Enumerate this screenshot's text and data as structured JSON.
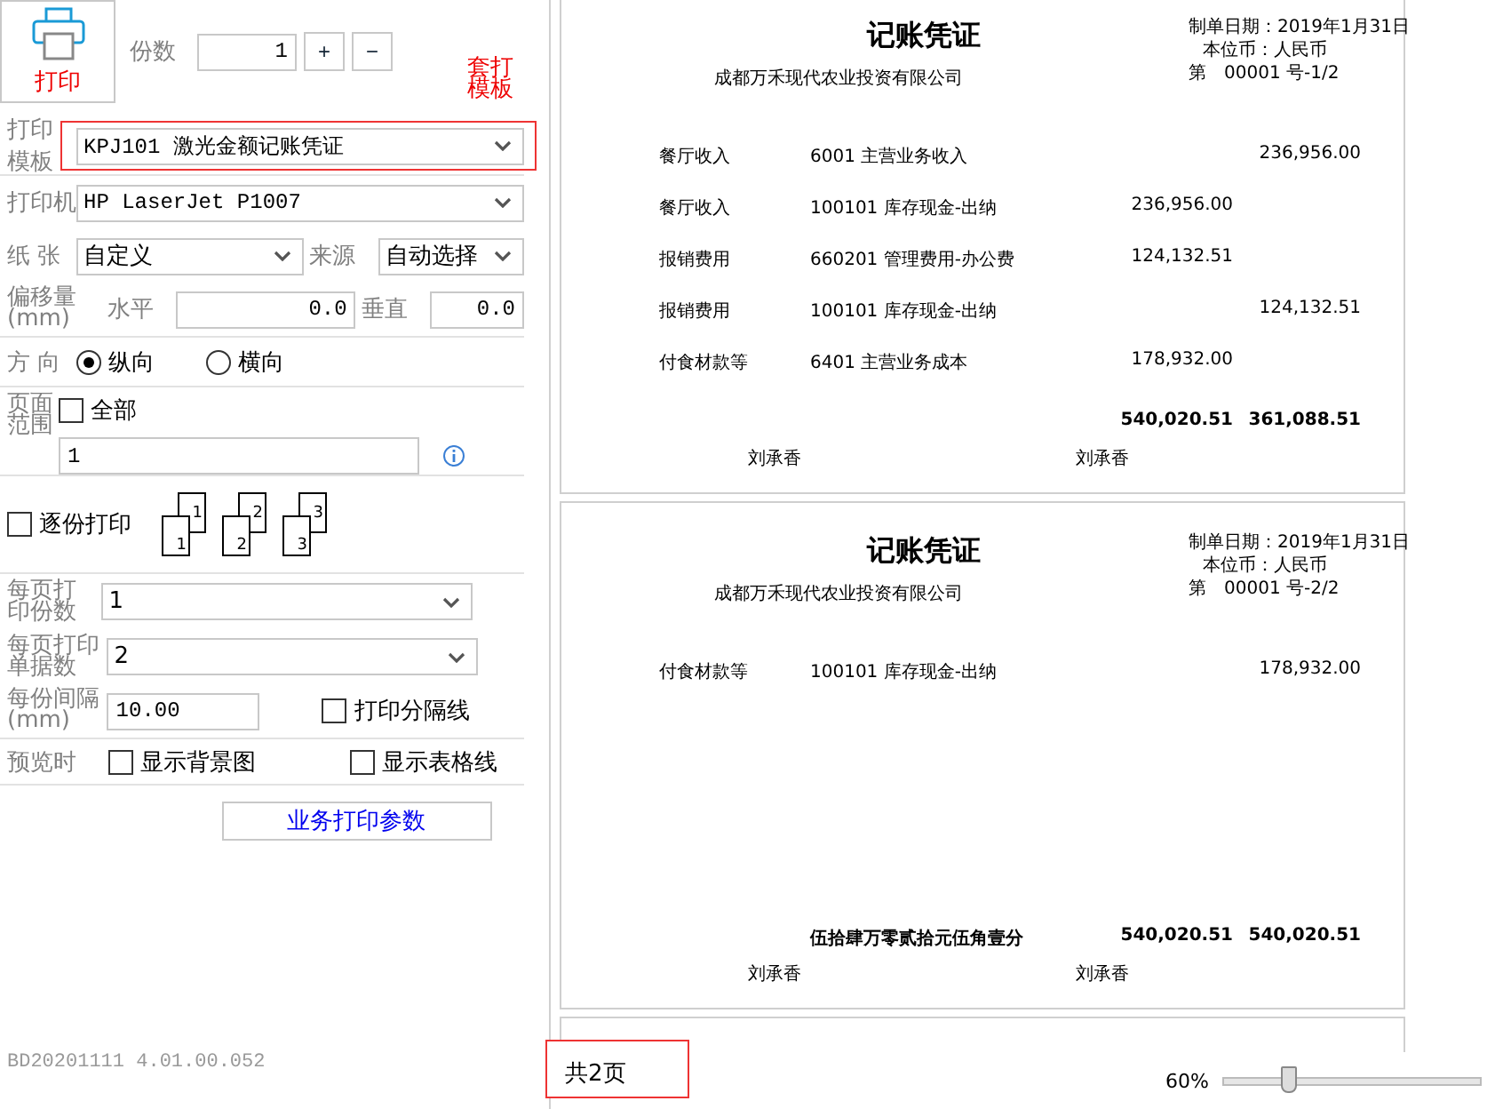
{
  "toolbar": {
    "print_button": "打印",
    "copies_label": "份数",
    "copies": "1",
    "increment": "+",
    "decrement": "−"
  },
  "template_note": "套打模板",
  "template": {
    "label": "打印模板",
    "value": "KPJ101 激光金额记账凭证",
    "highlighted": true
  },
  "printer": {
    "label": "打印机",
    "value": "HP LaserJet P1007"
  },
  "paper": {
    "label": "纸 张",
    "value": "自定义",
    "source_label": "来源",
    "source": "自动选择"
  },
  "offset": {
    "label": "偏移量(mm)",
    "horizontal_label": "水平",
    "horizontal": "0.0",
    "vertical_label": "垂直",
    "vertical": "0.0"
  },
  "orientation": {
    "label": "方 向",
    "options": [
      {
        "label": "纵向",
        "selected": true
      },
      {
        "label": "横向",
        "selected": false
      }
    ]
  },
  "page_range": {
    "label": "页面范围",
    "all": {
      "label": "全部",
      "checked": false
    },
    "value": "1"
  },
  "collate": {
    "label": "逐份打印",
    "checked": false,
    "stacks": [
      {
        "back": "1",
        "front": "1"
      },
      {
        "back": "2",
        "front": "2"
      },
      {
        "back": "3",
        "front": "3"
      }
    ]
  },
  "copies_per_page": {
    "label": "每页打印份数",
    "value": "1"
  },
  "docs_per_page": {
    "label": "每页打印单据数",
    "value": "2"
  },
  "interval": {
    "label": "每份间隔(mm)",
    "value": "10.00",
    "separator": {
      "label": "打印分隔线",
      "checked": false
    }
  },
  "preview_options": {
    "label": "预览时",
    "options": [
      {
        "label": "显示背景图",
        "checked": false
      },
      {
        "label": "显示表格线",
        "checked": false
      }
    ]
  },
  "params_button": "业务打印参数",
  "version": "BD20201111 4.01.00.052",
  "pages": [
    {
      "title": "记账凭证",
      "company": "成都万禾现代农业投资有限公司",
      "date": "制单日期：2019年1月31日",
      "currency": "本位币：人民币",
      "number": "第　00001 号-1/2",
      "rows": [
        {
          "summary": "餐厅收入",
          "account": "6001 主营业务收入",
          "credit": "236,956.00"
        },
        {
          "summary": "餐厅收入",
          "account": "100101 库存现金-出纳",
          "debit": "236,956.00"
        },
        {
          "summary": "报销费用",
          "account": "660201 管理费用-办公费",
          "debit": "124,132.51"
        },
        {
          "summary": "报销费用",
          "account": "100101 库存现金-出纳",
          "credit": "124,132.51"
        },
        {
          "summary": "付食材款等",
          "account": "6401 主营业务成本",
          "debit": "178,932.00"
        }
      ],
      "total": {
        "debit": "540,020.51",
        "credit": "361,088.51"
      },
      "signatures": [
        "刘承香",
        "刘承香"
      ]
    },
    {
      "title": "记账凭证",
      "company": "成都万禾现代农业投资有限公司",
      "date": "制单日期：2019年1月31日",
      "currency": "本位币：人民币",
      "number": "第　00001 号-2/2",
      "rows": [
        {
          "summary": "付食材款等",
          "account": "100101 库存现金-出纳",
          "credit": "178,932.00"
        }
      ],
      "total": {
        "words": "伍拾肆万零贰拾元伍角壹分",
        "debit": "540,020.51",
        "credit": "540,020.51"
      },
      "signatures": [
        "刘承香",
        "刘承香"
      ]
    }
  ],
  "more_pages_below": true,
  "status": {
    "page_count": "共2页",
    "highlighted": true,
    "zoom": "60%",
    "zoom_slider": {
      "level": 0.26
    }
  }
}
